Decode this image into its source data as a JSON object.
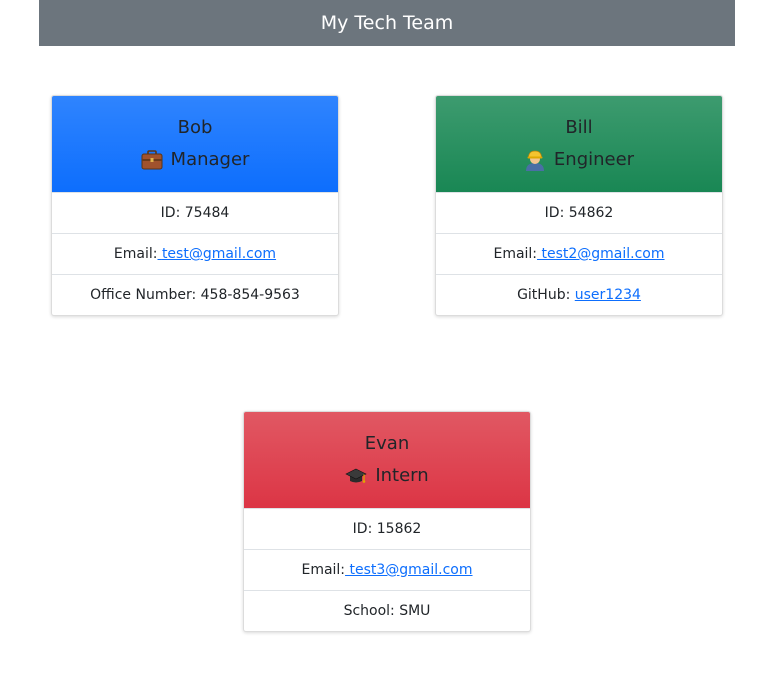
{
  "header": {
    "title": "My Tech Team"
  },
  "cards": [
    {
      "name": "Bob",
      "role": "Manager",
      "role_icon": "briefcase-icon",
      "header_color": "#0d6efd",
      "id_label": "ID:",
      "id": "75484",
      "email_label": "Email:",
      "email": "test@gmail.com",
      "extra_label": "Office Number:",
      "extra_value": "458-854-9563"
    },
    {
      "name": "Bill",
      "role": "Engineer",
      "role_icon": "construction-worker-icon",
      "header_color": "#198754",
      "id_label": "ID:",
      "id": "54862",
      "email_label": "Email:",
      "email": "test2@gmail.com",
      "extra_label": "GitHub:",
      "extra_value": "user1234"
    },
    {
      "name": "Evan",
      "role": "Intern",
      "role_icon": "graduation-cap-icon",
      "header_color": "#dc3545",
      "id_label": "ID:",
      "id": "15862",
      "email_label": "Email:",
      "email": "test3@gmail.com",
      "extra_label": "School:",
      "extra_value": "SMU"
    }
  ]
}
